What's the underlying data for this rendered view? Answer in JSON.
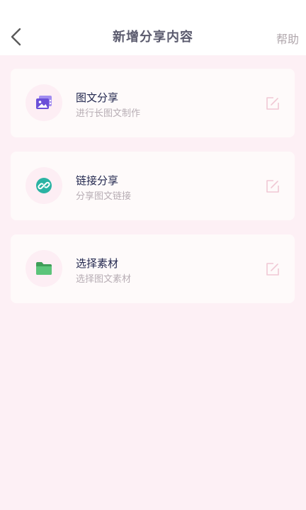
{
  "header": {
    "title": "新增分享内容",
    "help_label": "帮助"
  },
  "cards": [
    {
      "title": "图文分享",
      "subtitle": "进行长图文制作",
      "icon": "image-gallery-icon",
      "icon_color": "#6b4fd8"
    },
    {
      "title": "链接分享",
      "subtitle": "分享图文链接",
      "icon": "link-icon",
      "icon_color": "#2bb3a3"
    },
    {
      "title": "选择素材",
      "subtitle": "选择图文素材",
      "icon": "folder-icon",
      "icon_color": "#4db86a"
    }
  ],
  "colors": {
    "page_background": "#fdf0f5",
    "header_background": "#ffffff",
    "card_background": "#fefafa",
    "title_text": "#23284f",
    "subtitle_text": "#b7adb4",
    "edit_icon": "#f0c8d4"
  }
}
